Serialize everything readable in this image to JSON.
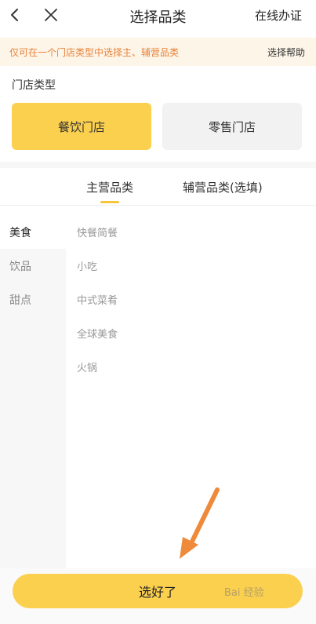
{
  "nav": {
    "title": "选择品类",
    "cert_label": "在线办证",
    "back_icon": "chevron-left-icon",
    "close_icon": "close-icon"
  },
  "notice": {
    "message": "仅可在一个门店类型中选择主、辅营品类",
    "help": "选择帮助"
  },
  "store_type": {
    "label": "门店类型",
    "options": [
      "餐饮门店",
      "零售门店"
    ],
    "selected": "餐饮门店"
  },
  "tabs": {
    "main": "主营品类",
    "sub": "辅营品类(选填)"
  },
  "sidebar": {
    "items": [
      "美食",
      "饮品",
      "甜点"
    ],
    "active": "美食"
  },
  "categories": [
    "快餐简餐",
    "小吃",
    "中式菜肴",
    "全球美食",
    "火锅"
  ],
  "footer": {
    "confirm_label": "选好了"
  },
  "watermark": {
    "text": "Bai 经验"
  },
  "colors": {
    "accent_yellow": "#fbd04f",
    "notice_text": "#e8833a",
    "annotation_arrow": "#ef8a3a"
  }
}
